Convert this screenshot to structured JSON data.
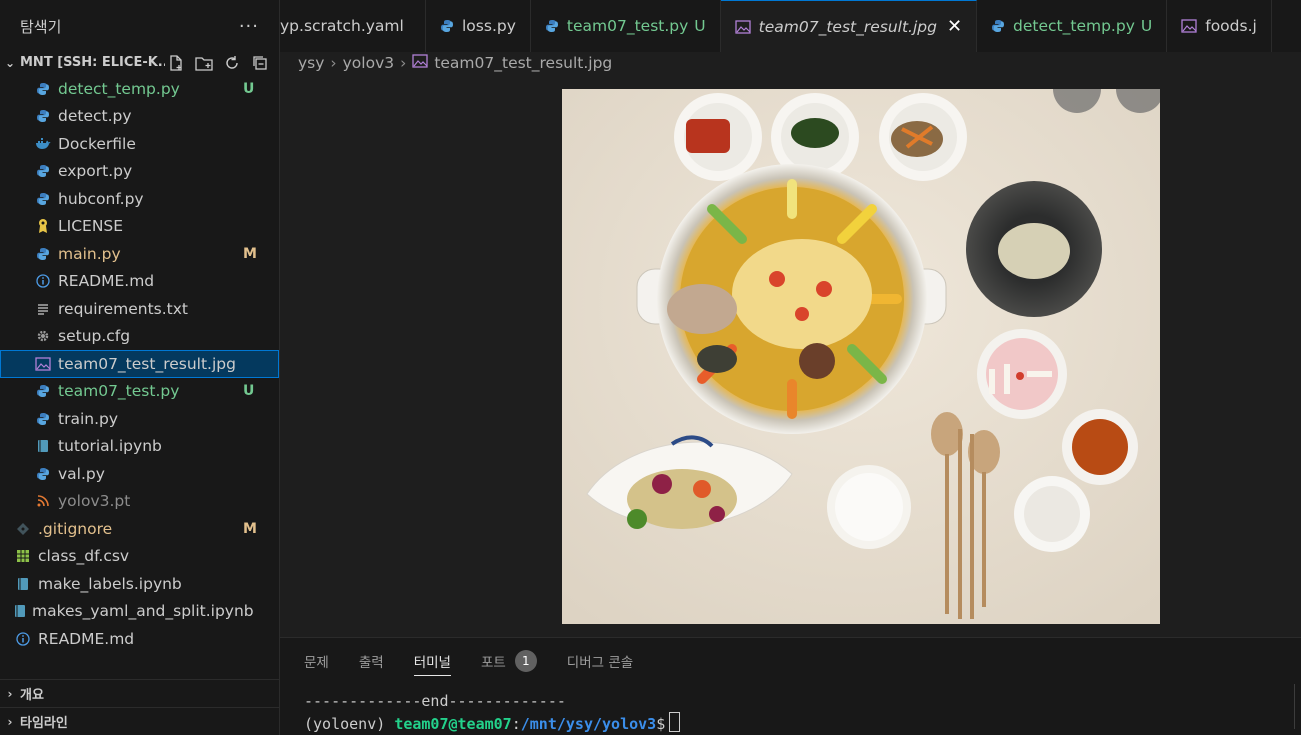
{
  "sidebar": {
    "title": "탐색기",
    "more": "···",
    "folder": "MNT [SSH: ELICE-K...",
    "files": [
      {
        "name": "detect_temp.py",
        "icon": "python-icon",
        "color": "u",
        "badge": "U"
      },
      {
        "name": "detect.py",
        "icon": "python-icon",
        "color": "n",
        "badge": ""
      },
      {
        "name": "Dockerfile",
        "icon": "docker-icon",
        "color": "n",
        "badge": ""
      },
      {
        "name": "export.py",
        "icon": "python-icon",
        "color": "n",
        "badge": ""
      },
      {
        "name": "hubconf.py",
        "icon": "python-icon",
        "color": "n",
        "badge": ""
      },
      {
        "name": "LICENSE",
        "icon": "license-icon",
        "color": "n",
        "badge": ""
      },
      {
        "name": "main.py",
        "icon": "python-icon",
        "color": "m",
        "badge": "M"
      },
      {
        "name": "README.md",
        "icon": "info-icon",
        "color": "n",
        "badge": ""
      },
      {
        "name": "requirements.txt",
        "icon": "text-file-icon",
        "color": "n",
        "badge": ""
      },
      {
        "name": "setup.cfg",
        "icon": "gear-icon",
        "color": "n",
        "badge": ""
      },
      {
        "name": "team07_test_result.jpg",
        "icon": "image-icon",
        "color": "n",
        "badge": ""
      },
      {
        "name": "team07_test.py",
        "icon": "python-icon",
        "color": "u",
        "badge": "U"
      },
      {
        "name": "train.py",
        "icon": "python-icon",
        "color": "n",
        "badge": ""
      },
      {
        "name": "tutorial.ipynb",
        "icon": "notebook-icon",
        "color": "n",
        "badge": ""
      },
      {
        "name": "val.py",
        "icon": "python-icon",
        "color": "n",
        "badge": ""
      },
      {
        "name": "yolov3.pt",
        "icon": "rss-icon",
        "color": "dim",
        "badge": ""
      },
      {
        "name": ".gitignore",
        "icon": "git-icon",
        "color": "m",
        "badge": "M"
      },
      {
        "name": "class_df.csv",
        "icon": "table-icon",
        "color": "n",
        "badge": ""
      },
      {
        "name": "make_labels.ipynb",
        "icon": "notebook-icon",
        "color": "n",
        "badge": ""
      },
      {
        "name": "makes_yaml_and_split.ipynb",
        "icon": "notebook-icon",
        "color": "n",
        "badge": ""
      },
      {
        "name": "README.md",
        "icon": "info-icon",
        "color": "n",
        "badge": ""
      }
    ],
    "sections": [
      "개요",
      "타임라인"
    ]
  },
  "tabs": [
    {
      "label": "yp.scratch.yaml",
      "icon": "",
      "color": "n",
      "marker": ""
    },
    {
      "label": "loss.py",
      "icon": "python-icon",
      "color": "n",
      "marker": ""
    },
    {
      "label": "team07_test.py",
      "icon": "python-icon",
      "color": "u",
      "marker": "U"
    },
    {
      "label": "team07_test_result.jpg",
      "icon": "image-icon",
      "color": "n",
      "marker": "",
      "active": true
    },
    {
      "label": "detect_temp.py",
      "icon": "python-icon",
      "color": "u",
      "marker": "U"
    },
    {
      "label": "foods.j",
      "icon": "image-icon",
      "color": "n",
      "marker": ""
    }
  ],
  "breadcrumb": [
    "ysy",
    "yolov3",
    "team07_test_result.jpg"
  ],
  "panel": {
    "tabs": [
      "문제",
      "출력",
      "터미널",
      "포트",
      "디버그 콘솔"
    ],
    "ports_count": "1",
    "terminal": {
      "line1": "-------------end-------------",
      "env": "(yoloenv) ",
      "user": "team07@team07",
      "colon": ":",
      "path": "/mnt/ysy/yolov3",
      "prompt": "$"
    }
  }
}
